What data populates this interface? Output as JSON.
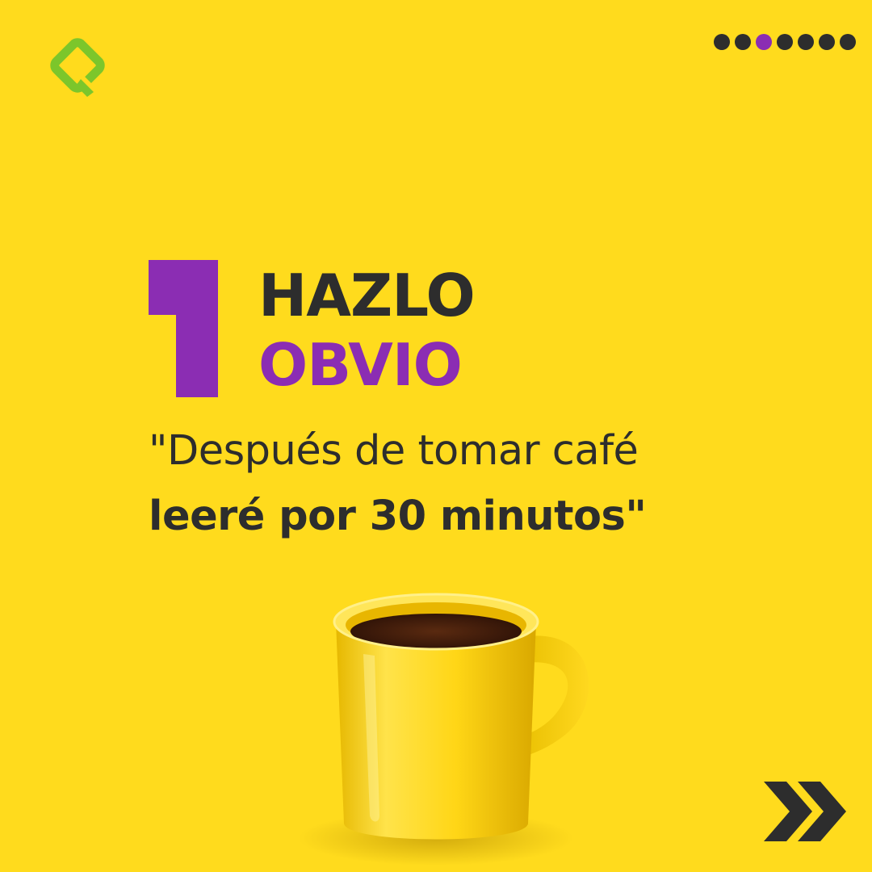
{
  "brand": {
    "logo_icon": "green-square-q-logo-icon",
    "logo_color": "#7CC62B"
  },
  "pagination": {
    "total": 7,
    "active_index": 2,
    "active_color": "#8B2DB3",
    "inactive_color": "#2D2D2D"
  },
  "slide": {
    "number": "1",
    "number_color": "#8B2DB3",
    "title_line1": "HAZLO",
    "title_line2": "OBVIO",
    "quote_line1": "\"Después de tomar café",
    "quote_line2": "leeré por 30 minutos\""
  },
  "illustration": {
    "icon": "coffee-mug-icon"
  },
  "navigation": {
    "next_icon": "double-chevron-right-icon"
  },
  "colors": {
    "background": "#FFDB1D",
    "text": "#2D2D2D",
    "accent": "#8B2DB3"
  }
}
